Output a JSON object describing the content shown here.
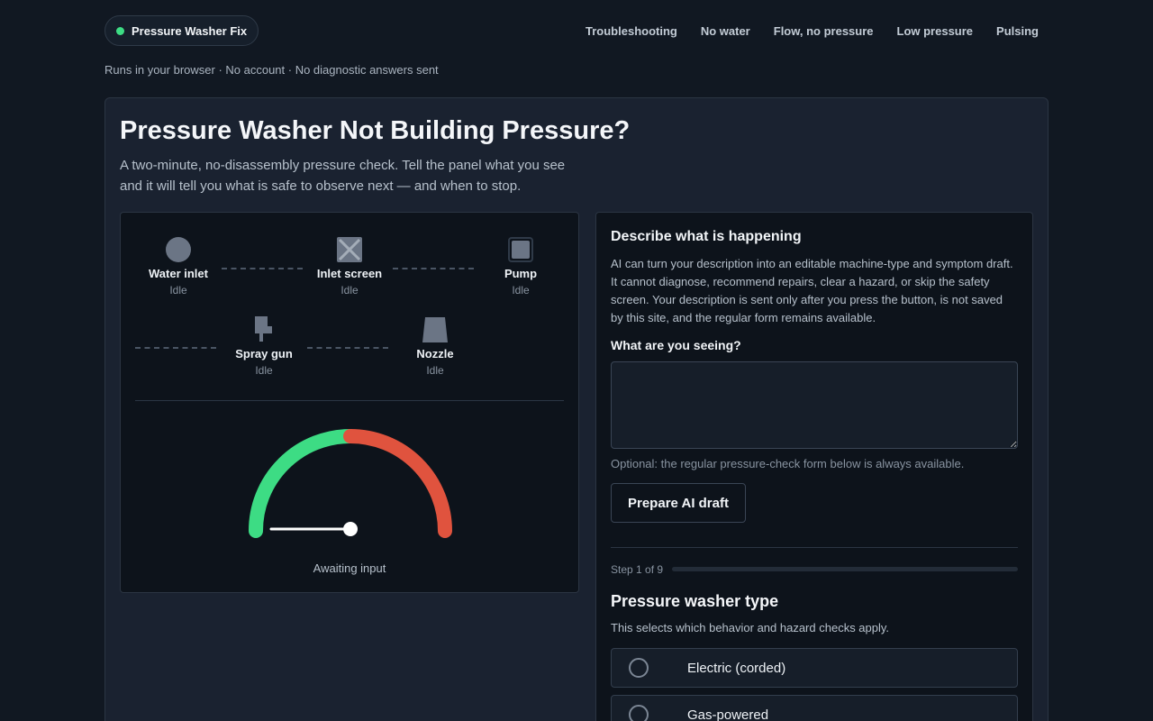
{
  "brand": {
    "name": "Pressure Washer Fix",
    "status_color": "#3ddc84"
  },
  "nav": [
    "Troubleshooting",
    "No water",
    "Flow, no pressure",
    "Low pressure",
    "Pulsing"
  ],
  "tagline": "Runs in your browser · No account · No diagnostic answers sent",
  "page": {
    "title": "Pressure Washer Not Building Pressure?",
    "lead": "A two-minute, no-disassembly pressure check. Tell the panel what you see and it will tell you what is safe to observe next — and when to stop."
  },
  "diagram": {
    "nodes": [
      {
        "name": "Water inlet",
        "status": "Idle",
        "icon": "circle-icon"
      },
      {
        "name": "Inlet screen",
        "status": "Idle",
        "icon": "screen-filter-icon"
      },
      {
        "name": "Pump",
        "status": "Idle",
        "icon": "pump-icon"
      },
      {
        "name": "Spray gun",
        "status": "Idle",
        "icon": "spray-gun-icon"
      },
      {
        "name": "Nozzle",
        "status": "Idle",
        "icon": "nozzle-icon"
      }
    ],
    "gauge": {
      "label": "Awaiting input",
      "level": 1.0,
      "colors": {
        "low": "#3ddc84",
        "high": "#e0533e",
        "needle": "#ffffff"
      }
    }
  },
  "ai_form": {
    "heading": "Describe what is happening",
    "description": "AI can turn your description into an editable machine-type and symptom draft. It cannot diagnose, recommend repairs, clear a hazard, or skip the safety screen. Your description is sent only after you press the button, is not saved by this site, and the regular form remains available.",
    "question_label": "What are you seeing?",
    "textarea_value": "",
    "optional_note": "Optional: the regular pressure-check form below is always available.",
    "button_label": "Prepare AI draft"
  },
  "wizard": {
    "step_text": "Step 1 of 9",
    "progress": 0,
    "heading": "Pressure washer type",
    "subtext": "This selects which behavior and hazard checks apply.",
    "options": [
      "Electric (corded)",
      "Gas-powered"
    ]
  }
}
